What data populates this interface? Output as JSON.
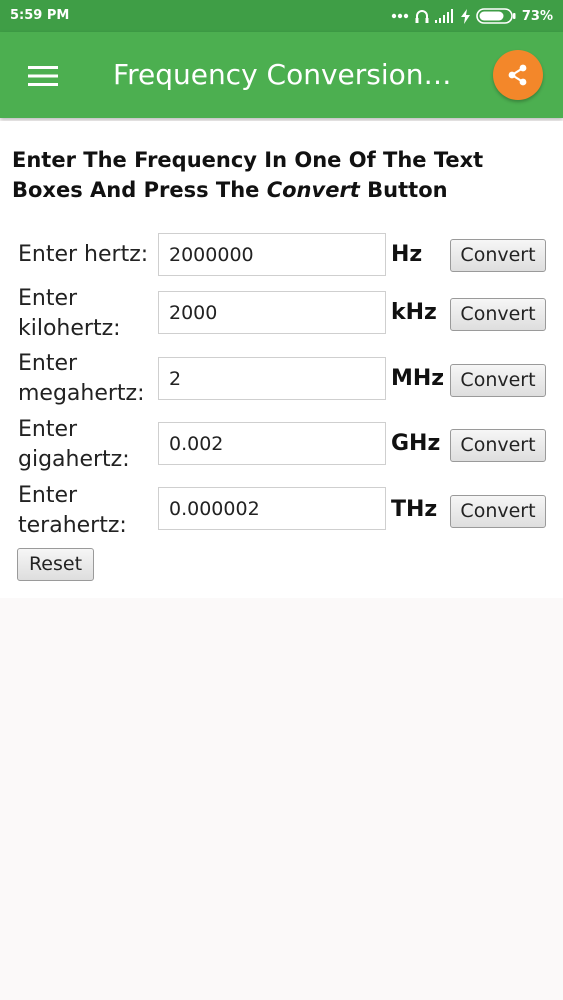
{
  "status_bar": {
    "time": "5:59 PM",
    "battery": "73%",
    "icons": [
      "more-dots-icon",
      "headphones-icon",
      "signal-icon",
      "charging-icon",
      "battery-icon"
    ]
  },
  "app_bar": {
    "title": "Frequency Conversion…",
    "menu_icon": "hamburger-menu-icon",
    "share_icon": "share-icon",
    "colors": {
      "status": "#3f9e46",
      "bar": "#4caf50",
      "share_button": "#f3872a"
    }
  },
  "instructions": {
    "before": "Enter The Frequency In One Of The Text Boxes And Press The ",
    "emphasis": "Convert",
    "after": " Button"
  },
  "rows": [
    {
      "label_line1": "Enter hertz:",
      "label_line2": "",
      "value": "2000000",
      "unit": "Hz",
      "button": "Convert"
    },
    {
      "label_line1": "Enter",
      "label_line2": "kilohertz:",
      "value": "2000",
      "unit": "kHz",
      "button": "Convert"
    },
    {
      "label_line1": "Enter",
      "label_line2": "megahertz:",
      "value": "2",
      "unit": "MHz",
      "button": "Convert"
    },
    {
      "label_line1": "Enter",
      "label_line2": "gigahertz:",
      "value": "0.002",
      "unit": "GHz",
      "button": "Convert"
    },
    {
      "label_line1": "Enter",
      "label_line2": "terahertz:",
      "value": "0.000002",
      "unit": "THz",
      "button": "Convert"
    }
  ],
  "reset_label": "Reset"
}
